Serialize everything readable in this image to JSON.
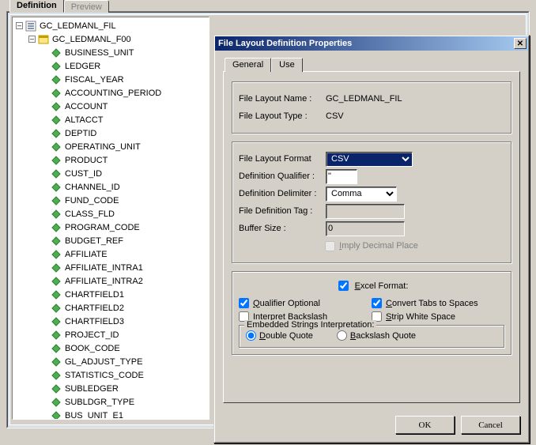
{
  "outer_tabs": {
    "active": "Definition",
    "inactive": "Preview"
  },
  "tree": {
    "root": "GC_LEDMANL_FIL",
    "child": "GC_LEDMANL_F00",
    "fields": [
      "BUSINESS_UNIT",
      "LEDGER",
      "FISCAL_YEAR",
      "ACCOUNTING_PERIOD",
      "ACCOUNT",
      "ALTACCT",
      "DEPTID",
      "OPERATING_UNIT",
      "PRODUCT",
      "CUST_ID",
      "CHANNEL_ID",
      "FUND_CODE",
      "CLASS_FLD",
      "PROGRAM_CODE",
      "BUDGET_REF",
      "AFFILIATE",
      "AFFILIATE_INTRA1",
      "AFFILIATE_INTRA2",
      "CHARTFIELD1",
      "CHARTFIELD2",
      "CHARTFIELD3",
      "PROJECT_ID",
      "BOOK_CODE",
      "GL_ADJUST_TYPE",
      "STATISTICS_CODE",
      "SUBLEDGER",
      "SUBLDGR_TYPE",
      "BUS_UNIT_E1"
    ]
  },
  "dialog": {
    "title": "File Layout Definition Properties",
    "tabs": {
      "general": "General",
      "use": "Use"
    },
    "name_label": "File Layout Name :",
    "name_value": "GC_LEDMANL_FIL",
    "type_label": "File Layout Type :",
    "type_value": "CSV",
    "format_label": "File Layout Format",
    "format_value": "CSV",
    "defq_label": "Definition Qualifier :",
    "defq_value": "\"",
    "defd_label": "Definition Delimiter :",
    "defd_value": "Comma",
    "tag_label": "File Definition Tag :",
    "tag_value": "",
    "buf_label": "Buffer Size :",
    "buf_value": "0",
    "imply_label": "Imply Decimal Place",
    "excel_label": "Excel Format:",
    "qual_opt": "Qualifier Optional",
    "conv_tabs": "Convert Tabs to Spaces",
    "interp_bs": "Interpret Backslash",
    "strip_ws": "Strip White Space",
    "embed_legend": "Embedded Strings Interpretation:",
    "dq": "Double Quote",
    "bq": "Backslash Quote",
    "ok": "OK",
    "cancel": "Cancel"
  }
}
